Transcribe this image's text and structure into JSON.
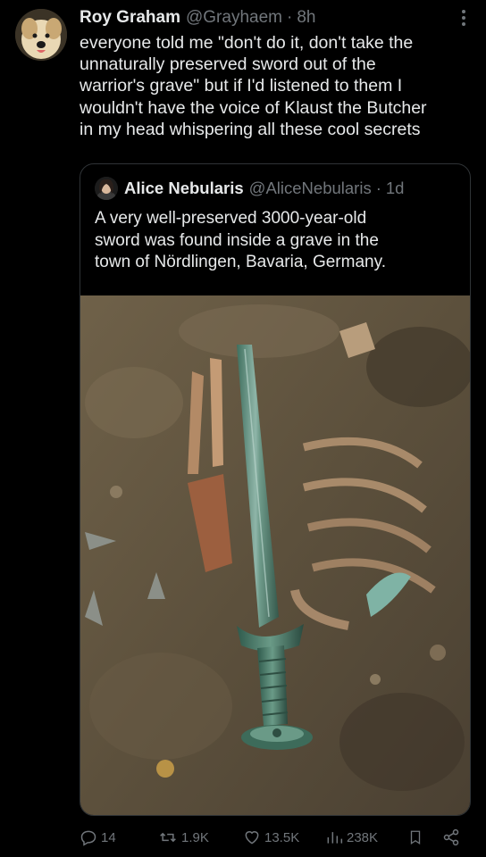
{
  "tweet": {
    "author_name": "Roy Graham",
    "author_handle": "@Grayhaem",
    "separator": "·",
    "time": "8h",
    "text_lines": [
      "everyone told me \"don't do it, don't take the",
      "unnaturally preserved sword out of the",
      "warrior's grave\" but if I'd listened to them I",
      "wouldn't have the voice of Klaust the Butcher",
      "in my head whispering all these cool secrets"
    ]
  },
  "quoted_tweet": {
    "author_name": "Alice Nebularis",
    "author_handle": "@AliceNebularis",
    "separator": "·",
    "time": "1d",
    "text_lines": [
      "A very well-preserved 3000-year-old",
      "sword was found inside a grave in the",
      "town of Nördlingen, Bavaria, Germany."
    ],
    "photo": "bronze sword in excavated grave beside skeleton"
  },
  "actions": {
    "replies": "14",
    "reposts": "1.9K",
    "likes": "13.5K",
    "views": "238K"
  },
  "icons": {
    "reply": "reply-icon",
    "repost": "repost-icon",
    "like": "heart-icon",
    "views": "views-icon",
    "bookmark": "bookmark-icon",
    "share": "share-icon",
    "more": "more-icon"
  },
  "colors": {
    "background": "#000000",
    "text": "#e7e9ea",
    "muted": "#71767b",
    "border": "#2f3336"
  }
}
